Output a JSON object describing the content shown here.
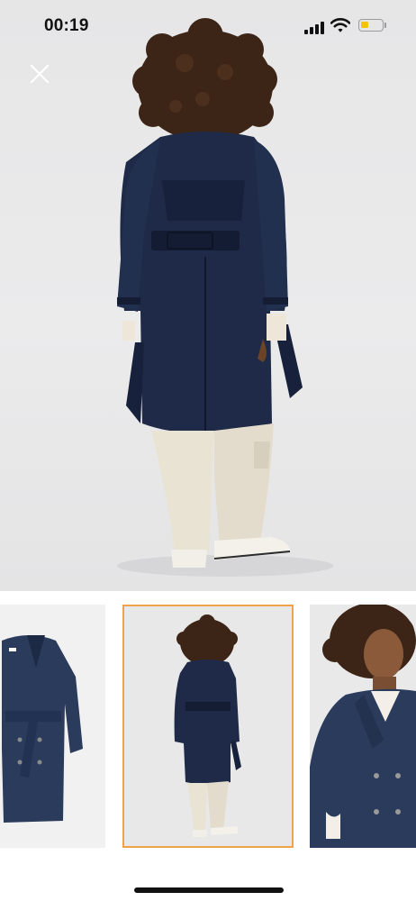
{
  "status_bar": {
    "time": "00:19",
    "icons": [
      "cellular-signal-icon",
      "wifi-icon",
      "battery-icon"
    ],
    "battery_fill_color": "#f3c300"
  },
  "main": {
    "close_icon": "close-icon",
    "image_subject": "back-view-trench-coat"
  },
  "thumbnails": [
    {
      "name": "coat-flat-lay",
      "selected": false
    },
    {
      "name": "coat-back-view",
      "selected": true
    },
    {
      "name": "coat-front-closeup",
      "selected": false
    }
  ],
  "colors": {
    "coat": "#1e2a47",
    "selected_border": "#f0a24a",
    "background": "#e8e8e9"
  }
}
